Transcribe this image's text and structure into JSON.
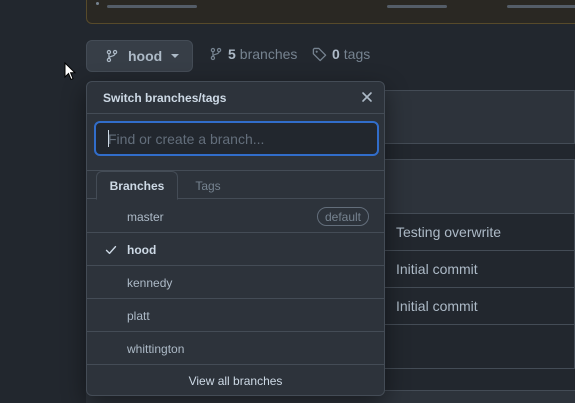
{
  "branch_selector": {
    "current_branch": "hood",
    "icon": "git-branch-icon"
  },
  "repo_stats": {
    "branches_count": "5",
    "branches_label": "branches",
    "tags_count": "0",
    "tags_label": "tags"
  },
  "dropdown": {
    "title": "Switch branches/tags",
    "filter_placeholder": "Find or create a branch...",
    "tabs": [
      {
        "label": "Branches",
        "active": true
      },
      {
        "label": "Tags",
        "active": false
      }
    ],
    "branches": [
      {
        "name": "master",
        "badge": "default",
        "current": false
      },
      {
        "name": "hood",
        "badge": "",
        "current": true
      },
      {
        "name": "kennedy",
        "badge": "",
        "current": false
      },
      {
        "name": "platt",
        "badge": "",
        "current": false
      },
      {
        "name": "whittington",
        "badge": "",
        "current": false
      }
    ],
    "footer_link": "View all branches"
  },
  "commit_messages": [
    "Testing overwrite",
    "Initial commit",
    "Initial commit"
  ],
  "colors": {
    "background": "#22272e",
    "panel": "#2d333b",
    "border": "#444c56",
    "accent": "#316dca",
    "text": "#adbac7"
  }
}
